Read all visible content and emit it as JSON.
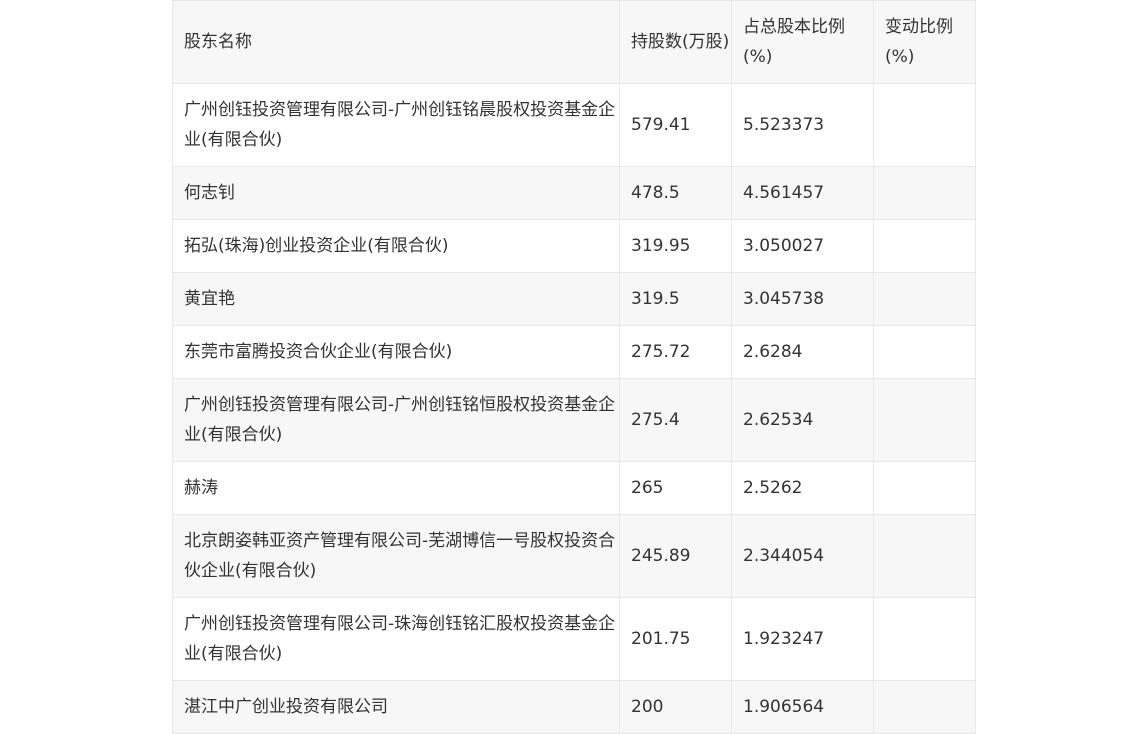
{
  "table": {
    "headers": [
      "股东名称",
      "持股数(万股)",
      "占总股本比例(%)",
      "变动比例(%)"
    ],
    "rows": [
      {
        "name": "广州创钰投资管理有限公司-广州创钰铭晨股权投资基金企业(有限合伙)",
        "shares": "579.41",
        "ratio": "5.523373",
        "change": ""
      },
      {
        "name": "何志钊",
        "shares": "478.5",
        "ratio": "4.561457",
        "change": ""
      },
      {
        "name": "拓弘(珠海)创业投资企业(有限合伙)",
        "shares": "319.95",
        "ratio": "3.050027",
        "change": ""
      },
      {
        "name": "黄宜艳",
        "shares": "319.5",
        "ratio": "3.045738",
        "change": ""
      },
      {
        "name": "东莞市富腾投资合伙企业(有限合伙)",
        "shares": "275.72",
        "ratio": "2.6284",
        "change": ""
      },
      {
        "name": "广州创钰投资管理有限公司-广州创钰铭恒股权投资基金企业(有限合伙)",
        "shares": "275.4",
        "ratio": "2.62534",
        "change": ""
      },
      {
        "name": "赫涛",
        "shares": "265",
        "ratio": "2.5262",
        "change": ""
      },
      {
        "name": "北京朗姿韩亚资产管理有限公司-芜湖博信一号股权投资合伙企业(有限合伙)",
        "shares": "245.89",
        "ratio": "2.344054",
        "change": ""
      },
      {
        "name": "广州创钰投资管理有限公司-珠海创钰铭汇股权投资基金企业(有限合伙)",
        "shares": "201.75",
        "ratio": "1.923247",
        "change": ""
      },
      {
        "name": "湛江中广创业投资有限公司",
        "shares": "200",
        "ratio": "1.906564",
        "change": ""
      }
    ]
  }
}
